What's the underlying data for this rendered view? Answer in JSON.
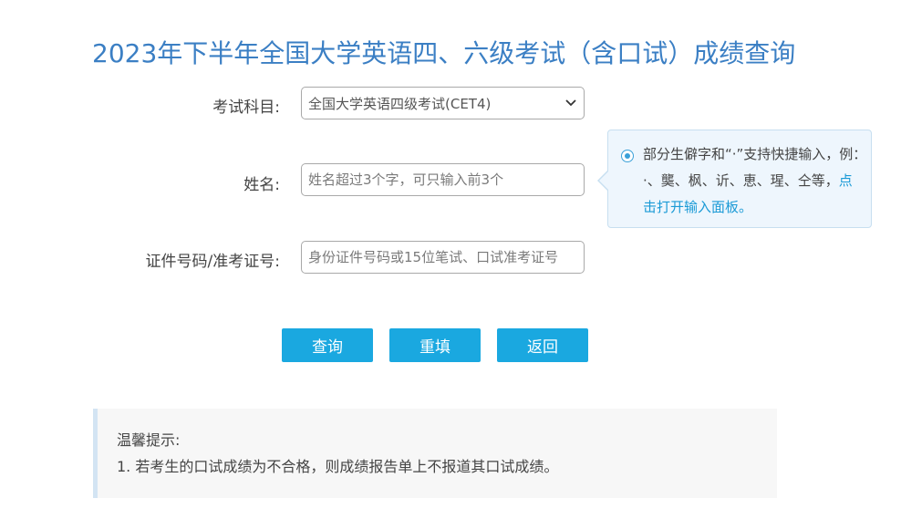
{
  "title": "2023年下半年全国大学英语四、六级考试（含口试）成绩查询",
  "form": {
    "subject": {
      "label": "考试科目:",
      "selected": "全国大学英语四级考试(CET4)"
    },
    "name": {
      "label": "姓名:",
      "placeholder": "姓名超过3个字，可只输入前3个"
    },
    "id": {
      "label": "证件号码/准考证号:",
      "placeholder": "身份证件号码或15位笔试、口试准考证号"
    }
  },
  "tip": {
    "text": "部分生僻字和“·”支持快捷输入，例：·、龑、枫、䜣、恵、瑆、仝等，",
    "link": "点击打开输入面板。"
  },
  "buttons": {
    "query": "查询",
    "reset": "重填",
    "back": "返回"
  },
  "notice": {
    "heading": "温馨提示:",
    "item1": "1. 若考生的口试成绩为不合格，则成绩报告单上不报道其口试成绩。"
  },
  "colors": {
    "title": "#3b7fc4",
    "button": "#1aa8e0",
    "link": "#1a9ad6"
  }
}
